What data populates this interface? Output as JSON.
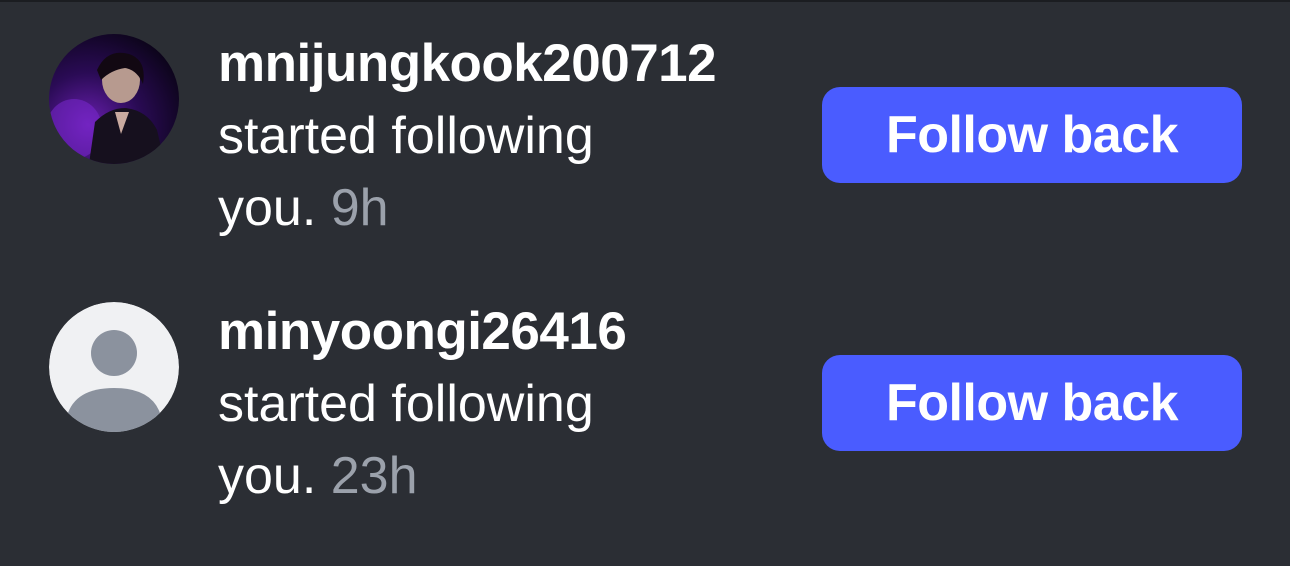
{
  "notifications": [
    {
      "username": "mnijungkook200712",
      "action": "started following you.",
      "timestamp": "9h",
      "button_label": "Follow back",
      "avatar": "profile-photo"
    },
    {
      "username": "minyoongi26416",
      "action": "started following you.",
      "timestamp": "23h",
      "button_label": "Follow back",
      "avatar": "default-user-icon"
    }
  ],
  "colors": {
    "background": "#2b2e34",
    "button": "#4a5cff",
    "timestamp": "#9ba1ab",
    "text": "#ffffff"
  }
}
